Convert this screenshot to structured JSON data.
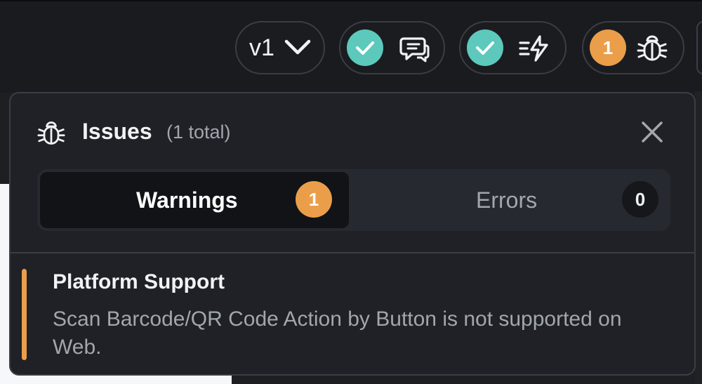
{
  "toolbar": {
    "version_label": "v1",
    "comments_status": "check",
    "actions_status": "check",
    "issues_count": "1"
  },
  "issues_panel": {
    "title": "Issues",
    "total_label": "(1 total)",
    "tabs": [
      {
        "label": "Warnings",
        "count": "1",
        "active": true
      },
      {
        "label": "Errors",
        "count": "0",
        "active": false
      }
    ],
    "items": [
      {
        "title": "Platform Support",
        "description": "Scan Barcode/QR Code Action by Button is not supported on Web.",
        "severity": "warning"
      }
    ]
  },
  "colors": {
    "accent_warning": "#eb9e4a",
    "success": "#5cc9bc",
    "panel_bg": "#1f2126",
    "page_bg": "#191b1f"
  },
  "icons": [
    "chevron-down-icon",
    "check-icon",
    "comment-icon",
    "lightning-icon",
    "bug-icon",
    "close-icon"
  ]
}
